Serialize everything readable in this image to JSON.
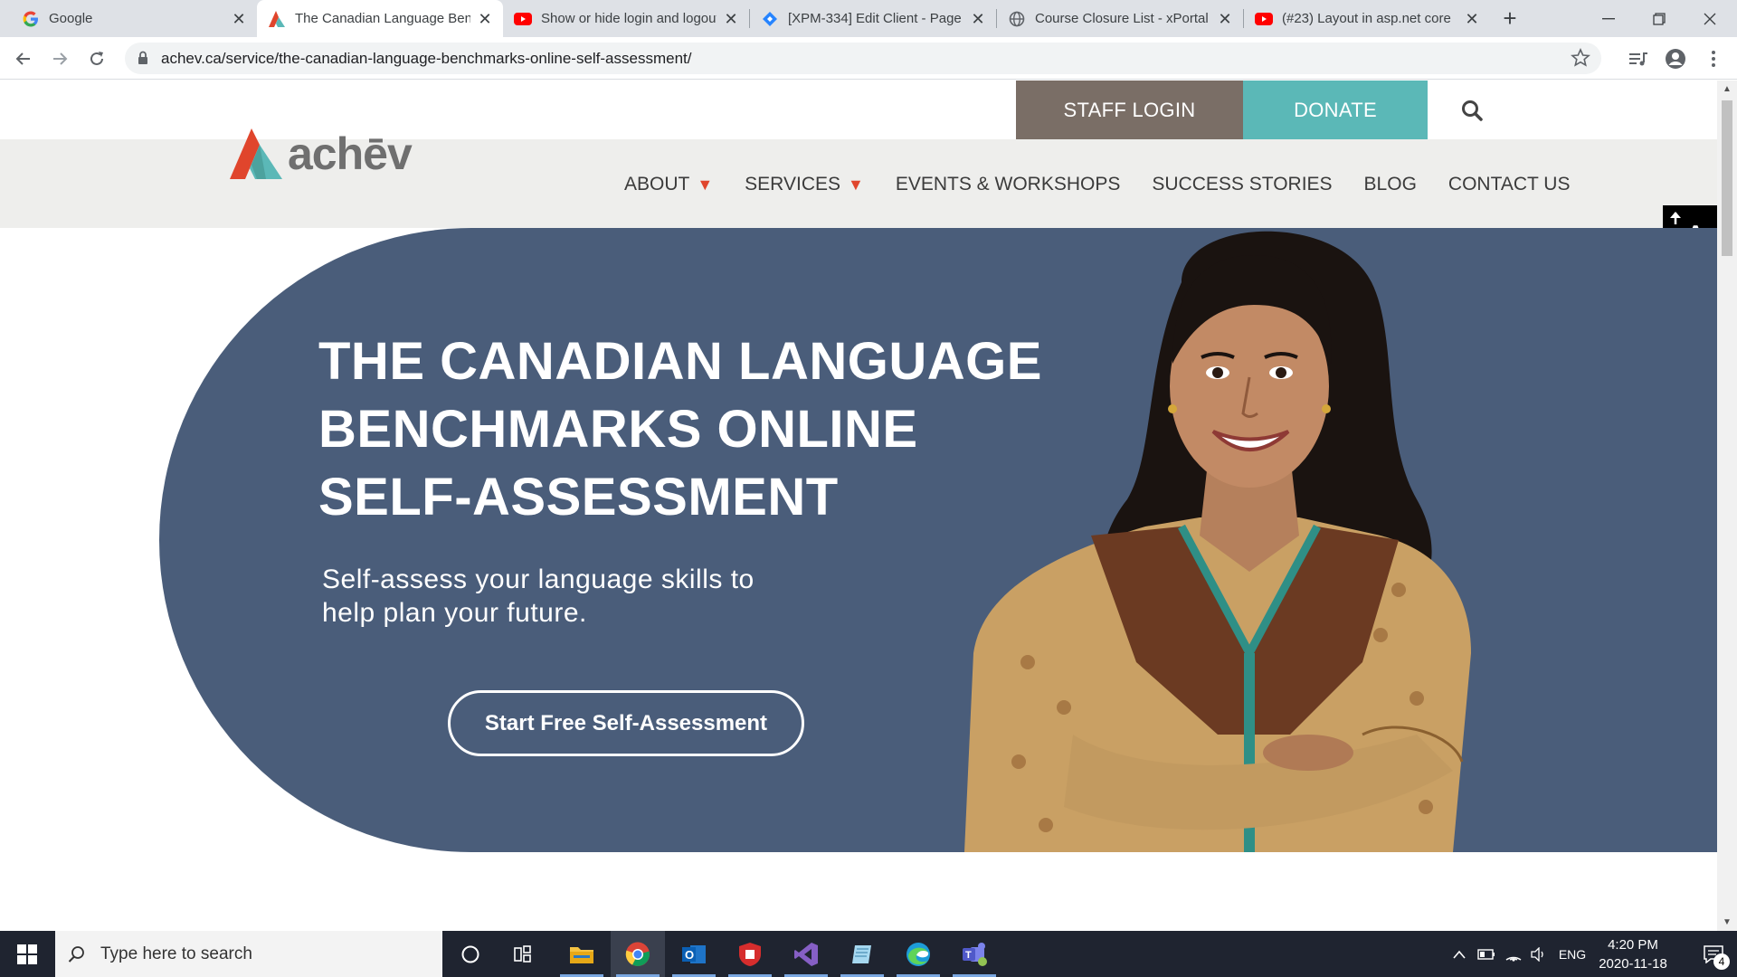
{
  "browser": {
    "tabs": [
      {
        "title": "Google",
        "icon": "google-icon"
      },
      {
        "title": "The Canadian Language Benchmarks Online Self-Assessment",
        "icon": "achev-icon",
        "active": true
      },
      {
        "title": "Show or hide login and logout",
        "icon": "youtube-icon"
      },
      {
        "title": "[XPM-334] Edit Client - Page",
        "icon": "jira-icon"
      },
      {
        "title": "Course Closure List - xPortal",
        "icon": "globe-icon"
      },
      {
        "title": "(#23) Layout in asp.net core",
        "icon": "youtube-icon"
      }
    ],
    "url": "achev.ca/service/the-canadian-language-benchmarks-online-self-assessment/"
  },
  "site": {
    "staff_login": "STAFF LOGIN",
    "donate": "DONATE",
    "logo_text": "achēv",
    "nav": [
      {
        "label": "ABOUT",
        "has_dropdown": true
      },
      {
        "label": "SERVICES",
        "has_dropdown": true
      },
      {
        "label": "EVENTS & WORKSHOPS",
        "has_dropdown": false
      },
      {
        "label": "SUCCESS STORIES",
        "has_dropdown": false
      },
      {
        "label": "BLOG",
        "has_dropdown": false
      },
      {
        "label": "CONTACT US",
        "has_dropdown": false
      }
    ],
    "accessibility_label": "AA",
    "hero": {
      "title_lines": [
        "THE CANADIAN LANGUAGE",
        "BENCHMARKS ONLINE",
        "SELF-ASSESSMENT"
      ],
      "subtitle_lines": [
        "Self-assess your language skills to",
        "help plan your future."
      ],
      "cta": "Start Free Self-Assessment"
    },
    "colors": {
      "hero_bg": "#4a5d7a",
      "staff_login_bg": "#7a6e66",
      "donate_bg": "#5bb8b7",
      "nav_caret": "#e0452c",
      "logo_red": "#e0452c",
      "logo_teal": "#5bb8b7"
    }
  },
  "taskbar": {
    "search_placeholder": "Type here to search",
    "apps": [
      "cortana-icon",
      "task-view-icon",
      "file-explorer-icon",
      "chrome-icon",
      "outlook-icon",
      "antivirus-icon",
      "visual-studio-icon",
      "notes-icon",
      "edge-icon",
      "teams-icon"
    ],
    "language": "ENG",
    "time": "4:20 PM",
    "date": "2020-11-18",
    "notification_count": "4"
  }
}
